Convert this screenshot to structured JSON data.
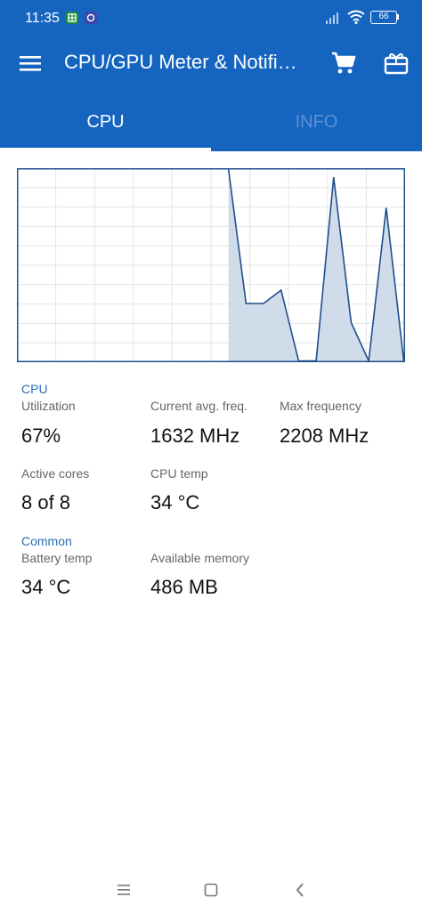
{
  "status": {
    "time": "11:35",
    "battery": "66",
    "app_icons": [
      "sheets-app-icon",
      "app-icon"
    ]
  },
  "appbar": {
    "title": "CPU/GPU Meter & Notifi…",
    "menu_icon": "hamburger-menu-icon",
    "cart_icon": "shopping-cart-icon",
    "gift_icon": "gift-card-icon"
  },
  "tabs": [
    {
      "label": "CPU",
      "selected": true
    },
    {
      "label": "INFO",
      "selected": false
    }
  ],
  "colors": {
    "primary": "#1565c0",
    "chart_line": "#1f4e8c",
    "chart_fill": "#c9d6e8",
    "section_accent": "#2a6db5"
  },
  "chart_data": {
    "type": "area",
    "title": "",
    "xlabel": "",
    "ylabel": "",
    "ylim": [
      0,
      100
    ],
    "grid": true,
    "x": [
      0,
      1,
      2,
      3,
      4,
      5,
      6,
      7,
      8,
      9,
      10,
      11,
      12,
      13,
      14,
      15,
      16,
      17,
      18,
      19
    ],
    "values": [
      null,
      null,
      null,
      null,
      null,
      null,
      null,
      null,
      null,
      null,
      null,
      null,
      100,
      30,
      30,
      37,
      0,
      0,
      96,
      20,
      0,
      80,
      0
    ]
  },
  "sections": {
    "cpu": {
      "label": "CPU",
      "utilization_label": "Utilization",
      "utilization_value": "67%",
      "avg_freq_label": "Current avg. freq.",
      "avg_freq_value": "1632 MHz",
      "max_freq_label": "Max frequency",
      "max_freq_value": "2208 MHz",
      "active_cores_label": "Active cores",
      "active_cores_value": "8 of 8",
      "cpu_temp_label": "CPU temp",
      "cpu_temp_value": "34 °C"
    },
    "common": {
      "label": "Common",
      "battery_temp_label": "Battery temp",
      "battery_temp_value": "34 °C",
      "memory_label": "Available memory",
      "memory_value": "486 MB"
    }
  },
  "navbar": {
    "recents_icon": "recents-menu-icon",
    "home_icon": "home-square-icon",
    "back_icon": "back-chevron-icon"
  }
}
